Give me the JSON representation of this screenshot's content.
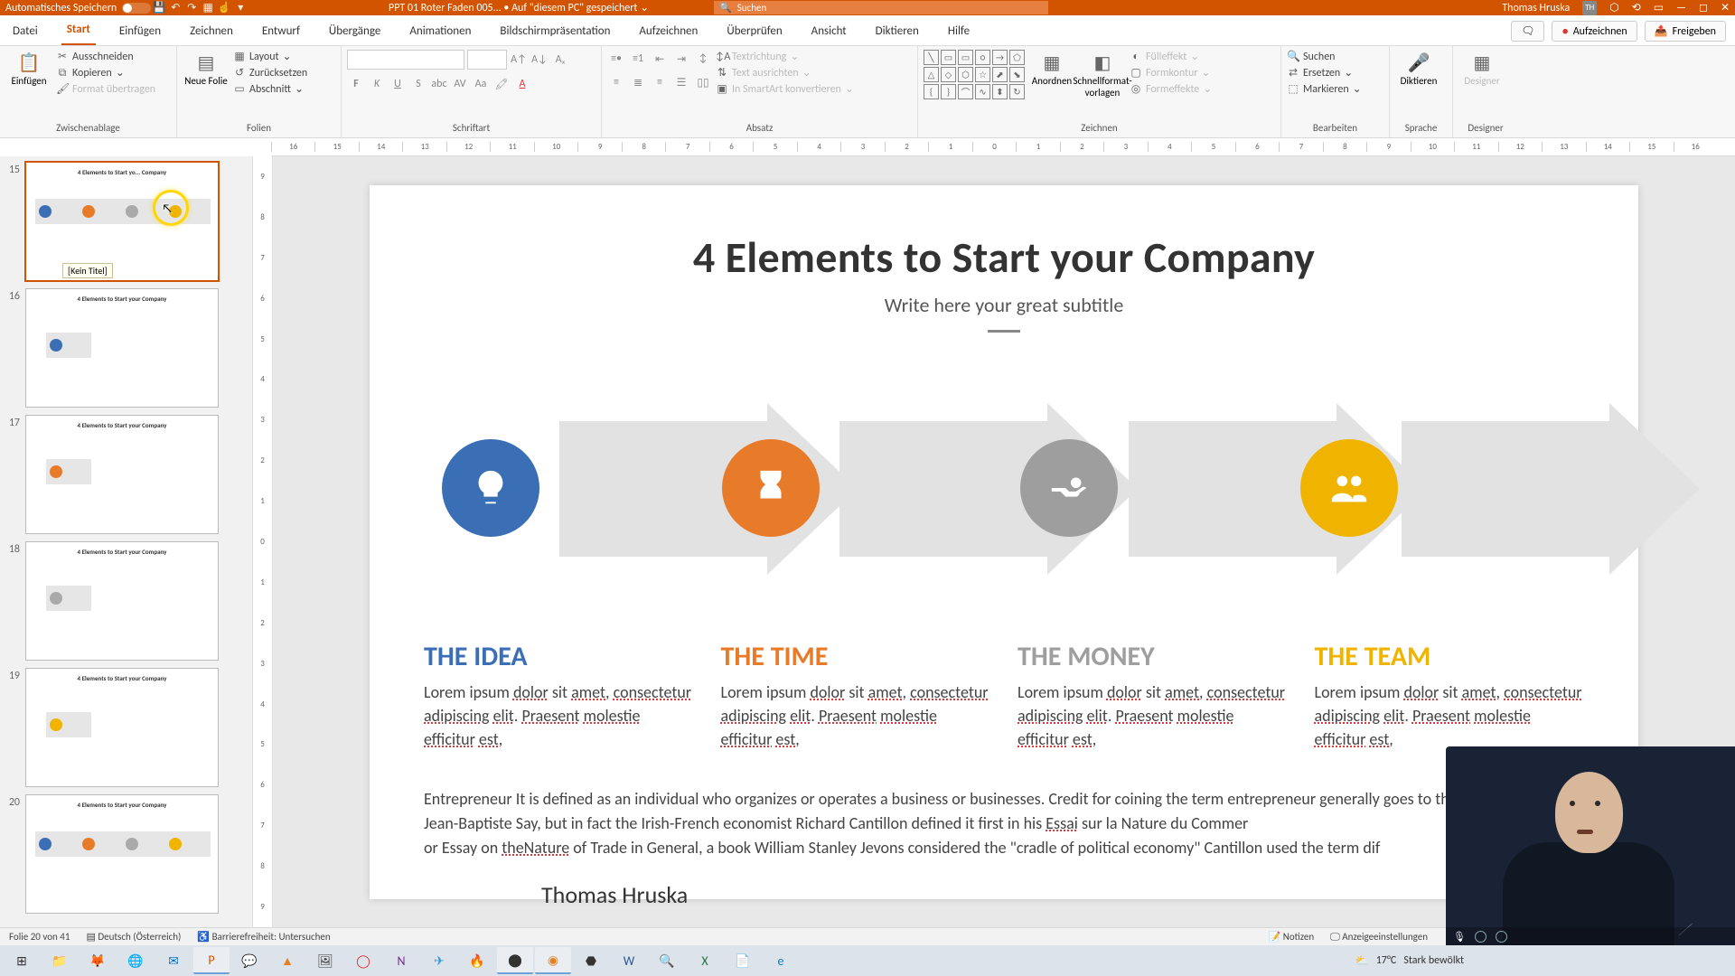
{
  "titlebar": {
    "autosave": "Automatisches Speichern",
    "doc": "PPT 01 Roter Faden 005...  •  Auf \"diesem PC\" gespeichert ⌄",
    "search_placeholder": "Suchen",
    "user": "Thomas Hruska",
    "user_initials": "TH"
  },
  "tabs": {
    "items": [
      "Datei",
      "Start",
      "Einfügen",
      "Zeichnen",
      "Entwurf",
      "Übergänge",
      "Animationen",
      "Bildschirmpräsentation",
      "Aufzeichnen",
      "Überprüfen",
      "Ansicht",
      "Diktieren",
      "Hilfe"
    ],
    "active": 1,
    "record": "Aufzeichnen",
    "share": "Freigeben"
  },
  "ribbon": {
    "clipboard": {
      "paste": "Einfügen",
      "cut": "Ausschneiden",
      "copy": "Kopieren",
      "format": "Format übertragen",
      "label": "Zwischenablage"
    },
    "slides": {
      "new": "Neue Folie",
      "layout": "Layout",
      "reset": "Zurücksetzen",
      "section": "Abschnitt",
      "label": "Folien"
    },
    "font": {
      "label": "Schriftart",
      "b": "F",
      "i": "K",
      "u": "U",
      "s": "S"
    },
    "para": {
      "label": "Absatz",
      "textdir": "Textrichtung",
      "align": "Text ausrichten",
      "smartart": "In SmartArt konvertieren"
    },
    "draw": {
      "label": "Zeichnen",
      "arrange": "Anordnen",
      "quick": "Schnellformat-vorlagen",
      "fill": "Fülleffekt",
      "outline": "Formkontur",
      "effects": "Formeffekte"
    },
    "edit": {
      "label": "Bearbeiten",
      "find": "Suchen",
      "replace": "Ersetzen",
      "select": "Markieren"
    },
    "voice": {
      "label": "Sprache",
      "dictate": "Diktieren"
    },
    "designer": {
      "label": "Designer",
      "designer": "Designer"
    }
  },
  "ruler_h": [
    "16",
    "15",
    "14",
    "13",
    "12",
    "11",
    "10",
    "9",
    "8",
    "7",
    "6",
    "5",
    "4",
    "3",
    "2",
    "1",
    "0",
    "1",
    "2",
    "3",
    "4",
    "5",
    "6",
    "7",
    "8",
    "9",
    "10",
    "11",
    "12",
    "13",
    "14",
    "15",
    "16"
  ],
  "ruler_v": [
    "9",
    "8",
    "7",
    "6",
    "5",
    "4",
    "3",
    "2",
    "1",
    "0",
    "1",
    "2",
    "3",
    "4",
    "5",
    "6",
    "7",
    "8",
    "9"
  ],
  "thumbs": {
    "start": 15,
    "list": [
      {
        "n": 15,
        "sel": true,
        "title": "4 Elements to Start yo... Company",
        "tip": "[Kein Titel]",
        "dots": [
          "#3b6fb5",
          "#e87b2a",
          "#aaaaaa",
          "#f0b400"
        ]
      },
      {
        "n": 16,
        "title": "4 Elements to Start your Company",
        "dots": [
          "#3b6fb5"
        ]
      },
      {
        "n": 17,
        "title": "4 Elements to Start your Company",
        "dots": [
          "#e87b2a"
        ]
      },
      {
        "n": 18,
        "title": "4 Elements to Start your Company",
        "dots": [
          "#aaaaaa"
        ]
      },
      {
        "n": 19,
        "title": "4 Elements to Start your Company",
        "dots": [
          "#f0b400"
        ]
      },
      {
        "n": 20,
        "title": "4 Elements to Start your Company",
        "dots": [
          "#3b6fb5",
          "#e87b2a",
          "#aaaaaa",
          "#f0b400"
        ]
      }
    ]
  },
  "slide": {
    "title": "4 Elements to Start your Company",
    "subtitle": "Write here your great subtitle",
    "elements": [
      {
        "h": "THE IDEA",
        "color": "#3b6fb5"
      },
      {
        "h": "THE TIME",
        "color": "#e87b2a"
      },
      {
        "h": "THE MONEY",
        "color": "#9e9e9e"
      },
      {
        "h": "THE TEAM",
        "color": "#f0b400"
      }
    ],
    "lorem_a": "Lorem ipsum ",
    "lorem_dolor": "dolor",
    "lorem_b": " sit ",
    "lorem_amet": "amet",
    "lorem_c": ", ",
    "lorem_cons": "consectetur",
    "lorem_d": " ",
    "lorem_adip": "adipiscing",
    "lorem_e": " ",
    "lorem_elit": "elit",
    "lorem_f": ". ",
    "lorem_pr": "Praesent",
    "lorem_g": " ",
    "lorem_mol": "molestie",
    "lorem_h": " ",
    "lorem_eff": "efficitur",
    "lorem_i": " ",
    "lorem_est": "est",
    "lorem_j": ",",
    "para_a": "Entrepreneur  It is defined as an individual who organizes or operates a business or businesses. Credit for coining the term entrepreneur generally goes to the French economist Jean-Baptiste Say, but in fact the Irish-French economist Richard Cantillon defined it first in his ",
    "para_essai": "Essai",
    "para_b": " sur la Nature du Commer",
    "para_c": "or Essay on ",
    "para_nat": "theNature",
    "para_d": " of Trade in General, a book William Stanley Jevons considered the \"cradle of political economy\" Cantillon used the term dif",
    "author": "Thomas Hruska"
  },
  "status": {
    "slide": "Folie 20 von 41",
    "lang": "Deutsch (Österreich)",
    "access": "Barrierefreiheit: Untersuchen",
    "notes": "Notizen",
    "display": "Anzeigeeinstellungen"
  },
  "taskbar": {
    "weather_temp": "17°C",
    "weather_text": "Stark bewölkt"
  }
}
